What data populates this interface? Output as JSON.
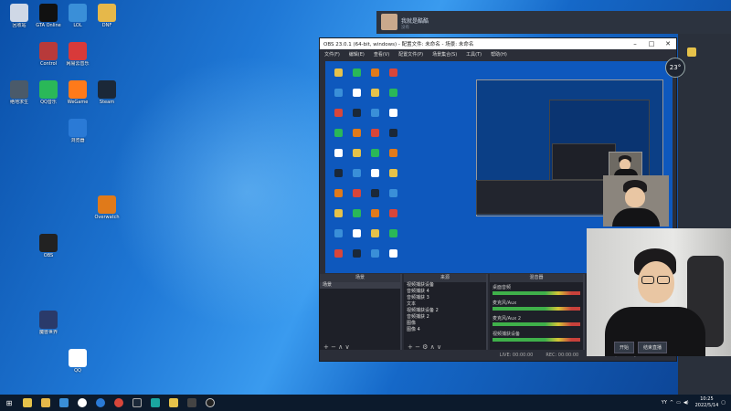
{
  "desktop_icons": [
    {
      "label": "回收站",
      "color": "#cfd8e6",
      "col": 0,
      "row": 0
    },
    {
      "label": "GTA Online",
      "color": "#111",
      "col": 1,
      "row": 0
    },
    {
      "label": "LOL",
      "color": "#3a8fd8",
      "col": 2,
      "row": 0
    },
    {
      "label": "DNF",
      "color": "#e6b84a",
      "col": 3,
      "row": 0
    },
    {
      "label": "Control",
      "color": "#b83a3a",
      "col": 1,
      "row": 1
    },
    {
      "label": "网易云音乐",
      "color": "#d83a3a",
      "col": 2,
      "row": 1
    },
    {
      "label": "绝地求生",
      "color": "#4a5a6a",
      "col": 0,
      "row": 2
    },
    {
      "label": "Steam",
      "color": "#1b2838",
      "col": 3,
      "row": 2
    },
    {
      "label": "QQ音乐",
      "color": "#2ab858",
      "col": 1,
      "row": 2
    },
    {
      "label": "WeGame",
      "color": "#ff7a1a",
      "col": 2,
      "row": 2
    },
    {
      "label": "浏览器",
      "color": "#2a7ad6",
      "col": 2,
      "row": 3
    },
    {
      "label": "QQ",
      "color": "#fff",
      "col": 2,
      "row": 9
    },
    {
      "label": "OBS",
      "color": "#222",
      "col": 1,
      "row": 6
    },
    {
      "label": "Overwatch",
      "color": "#e07a1a",
      "col": 3,
      "row": 5
    },
    {
      "label": "魔兽世界",
      "color": "#2a3a6a",
      "col": 1,
      "row": 8
    }
  ],
  "obs": {
    "title": "OBS 23.0.1 (64-bit, windows) - 配置文件: 未命名 - 场景: 未命名",
    "menu": [
      "文件(F)",
      "编辑(E)",
      "查看(V)",
      "配置文件(P)",
      "场景集合(S)",
      "工具(T)",
      "帮助(H)"
    ],
    "docks": {
      "scenes_label": "场景",
      "scene_item": "场景",
      "sources_label": "来源",
      "sources": [
        "视频捕获设备",
        "音频捕获 4",
        "音频捕获 3",
        "文本",
        "视频捕获设备 2",
        "音频捕获 2",
        "图像",
        "图像 4"
      ],
      "mixer_label": "混音器",
      "mixer": [
        "桌面音频",
        "麦克风/Aux",
        "麦克风/Aux 2",
        "视频捕获设备"
      ]
    },
    "status": [
      "LIVE: 00:00:00",
      "REC: 00:00:00",
      "CPU: 0.9%, 60.00 fps"
    ]
  },
  "stream": {
    "streamer_name": "我就是酷酷",
    "streamer_sub": "没有",
    "temp_badge": "23",
    "cam_buttons": [
      "开始",
      "结束直播"
    ]
  },
  "taskbar": {
    "start_icon": "windows-icon",
    "tray_text": "YY",
    "time": "10:25",
    "date": "2022/5/14"
  }
}
